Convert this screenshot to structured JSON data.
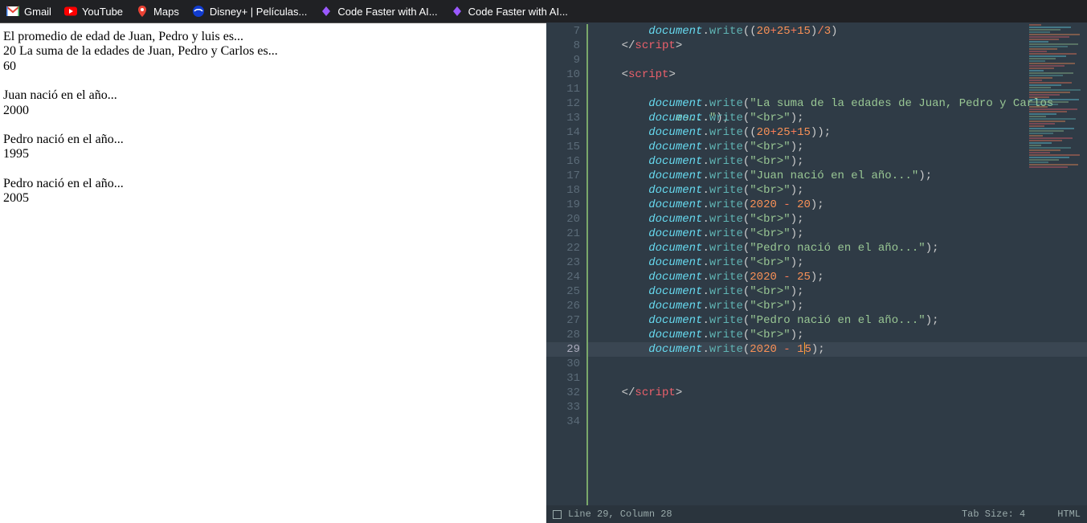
{
  "bookmarks": [
    {
      "label": "Gmail",
      "icon": "gmail"
    },
    {
      "label": "YouTube",
      "icon": "youtube"
    },
    {
      "label": "Maps",
      "icon": "maps"
    },
    {
      "label": "Disney+ | Películas...",
      "icon": "disney"
    },
    {
      "label": "Code Faster with AI...",
      "icon": "code1"
    },
    {
      "label": "Code Faster with AI...",
      "icon": "code2"
    }
  ],
  "page_output": {
    "line1": "El promedio de edad de Juan, Pedro y luis es...",
    "line2": "20 La suma de la edades de Juan, Pedro y Carlos es...",
    "line3": "60",
    "juan_label": "Juan nació en el año...",
    "juan_year": "2000",
    "pedro_label": "Pedro nació en el año...",
    "pedro_year": "1995",
    "pedro2_label": "Pedro nació en el año...",
    "pedro2_year": "2005"
  },
  "editor": {
    "first_line_no": 7,
    "last_line_no": 34,
    "highlighted_line": 29
  },
  "statusbar": {
    "position": "Line 29, Column 28",
    "tab": "Tab Size: 4",
    "lang": "HTML"
  }
}
